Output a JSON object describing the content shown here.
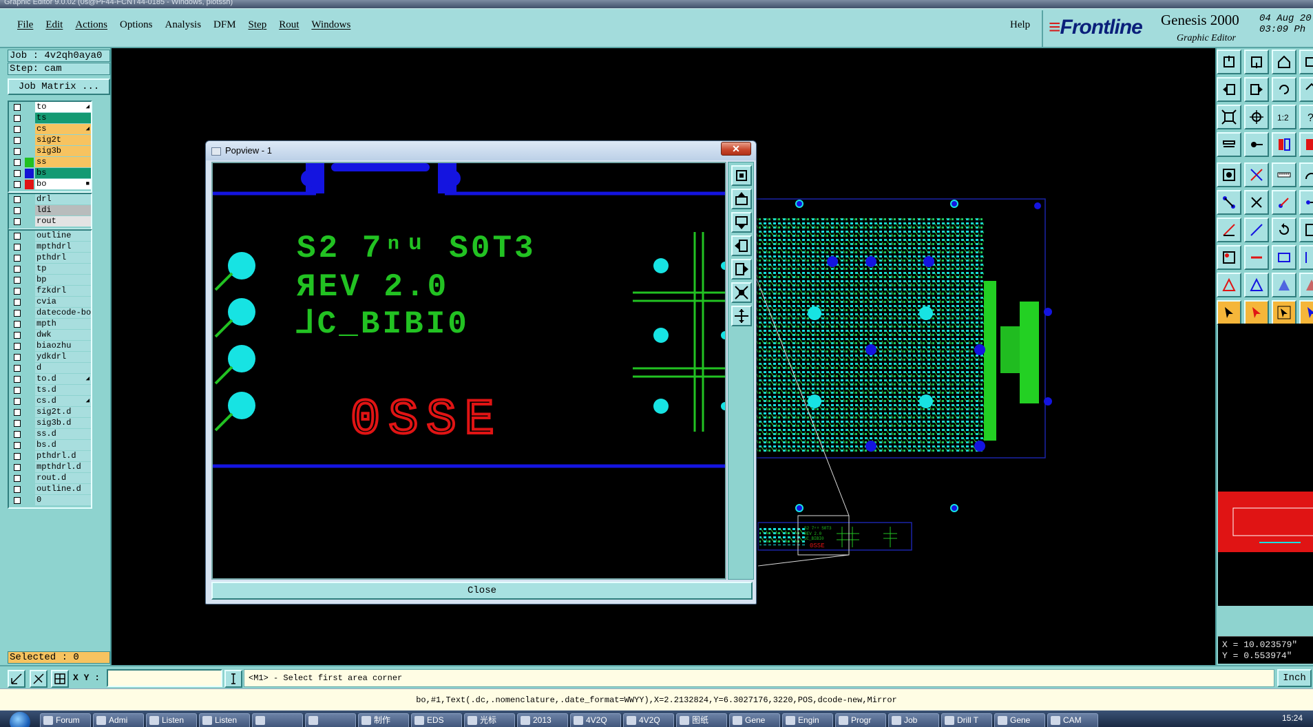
{
  "window": {
    "title": "Graphic Editor 9.0.02 (0s@PF44-FCNT44-0185 - Windows, plotssh)"
  },
  "menubar": {
    "menus": [
      "File",
      "Edit",
      "Actions",
      "Options",
      "Analysis",
      "DFM",
      "Step",
      "Rout",
      "Windows"
    ],
    "help": "Help"
  },
  "brand": {
    "logo": "Frontline",
    "product": "Genesis 2000",
    "subtitle": "Graphic Editor",
    "date": "04 Aug 20",
    "time": "03:09 Ph"
  },
  "job": {
    "job_label": "Job : 4v2qh0aya0",
    "step_label": "Step: cam",
    "matrix_button": "Job Matrix ..."
  },
  "layers_board": [
    {
      "name": "to",
      "bg": "#ffffff",
      "swatch": "",
      "mark": "◢"
    },
    {
      "name": "ts",
      "bg": "#149a73",
      "swatch": "",
      "mark": ""
    },
    {
      "name": "cs",
      "bg": "#f7c360",
      "swatch": "",
      "mark": "◢"
    },
    {
      "name": "sig2t",
      "bg": "#f7c360",
      "swatch": "",
      "mark": ""
    },
    {
      "name": "sig3b",
      "bg": "#f7c360",
      "swatch": "",
      "mark": ""
    },
    {
      "name": "ss",
      "bg": "#f7c360",
      "swatch": "#21c021",
      "mark": ""
    },
    {
      "name": "bs",
      "bg": "#149a73",
      "swatch": "#1414d4",
      "mark": ""
    },
    {
      "name": "bo",
      "bg": "#ffffff",
      "swatch": "#e01414",
      "mark": "■"
    }
  ],
  "layers_drill": [
    {
      "name": "drl",
      "bg": "#a8dede",
      "swatch": "",
      "mark": ""
    },
    {
      "name": "ldi",
      "bg": "#b8bcbc",
      "swatch": "",
      "mark": ""
    },
    {
      "name": "rout",
      "bg": "#e3e3e3",
      "swatch": "",
      "mark": ""
    }
  ],
  "layers_misc": [
    {
      "name": "outline",
      "mark": ""
    },
    {
      "name": "mpthdrl",
      "mark": ""
    },
    {
      "name": "pthdrl",
      "mark": ""
    },
    {
      "name": "tp",
      "mark": ""
    },
    {
      "name": "bp",
      "mark": ""
    },
    {
      "name": "fzkdrl",
      "mark": ""
    },
    {
      "name": "cvia",
      "mark": ""
    },
    {
      "name": "datecode-bo",
      "mark": ""
    },
    {
      "name": "mpth",
      "mark": ""
    },
    {
      "name": "dwk",
      "mark": ""
    },
    {
      "name": "biaozhu",
      "mark": ""
    },
    {
      "name": "ydkdrl",
      "mark": ""
    },
    {
      "name": "d",
      "mark": ""
    },
    {
      "name": "to.d",
      "mark": "◢"
    },
    {
      "name": "ts.d",
      "mark": ""
    },
    {
      "name": "cs.d",
      "mark": "◢"
    },
    {
      "name": "sig2t.d",
      "mark": ""
    },
    {
      "name": "sig3b.d",
      "mark": ""
    },
    {
      "name": "ss.d",
      "mark": ""
    },
    {
      "name": "bs.d",
      "mark": ""
    },
    {
      "name": "pthdrl.d",
      "mark": ""
    },
    {
      "name": "mpthdrl.d",
      "mark": ""
    },
    {
      "name": "rout.d",
      "mark": ""
    },
    {
      "name": "outline.d",
      "mark": ""
    },
    {
      "name": "0",
      "mark": ""
    }
  ],
  "selected": "Selected : 0",
  "popview": {
    "title": "Popview - 1",
    "close_x": "✕",
    "close_button": "Close",
    "silk_line1": "S2 7ⁿᵘ S0T3",
    "silk_line2": "ЯEV 2.0",
    "silk_line3": "⅃C_BIBI0",
    "datecode": "0SSE"
  },
  "overview": {
    "mini_line1": "S2 7ⁿᵘ S0T3",
    "mini_line2": "ЯEV 2.0",
    "mini_line3": "⅃C_BIBI0",
    "mini_datecode": "0SSE"
  },
  "coords": {
    "x": "X = 10.023579\"",
    "y": "Y = 0.553974\""
  },
  "cmd": {
    "xy_label": "X Y :",
    "xy_value": "",
    "prompt": "<M1> - Select first area corner",
    "unit": "Inch"
  },
  "status": "bo,#1,Text(.dc,.nomenclature,.date_format=WWYY),X=2.2132824,Y=6.3027176,3220,POS,dcode-new,Mirror",
  "taskbar": {
    "tasks": [
      "Forum",
      "Admi",
      "Listen",
      "Listen",
      "",
      "",
      "制作",
      "EDS",
      "光标",
      "2013",
      "4V2Q",
      "4V2Q",
      "图纸",
      "Gene",
      "Engin",
      "Progr",
      "Job",
      "Drill T",
      "Gene",
      "CAM"
    ],
    "clock": "15:24"
  },
  "colors": {
    "panel": "#8ed3cf",
    "menubar": "#a3dcdc",
    "silkscreen": "#22c222",
    "copper_blue": "#1414e0",
    "pad_cyan": "#17e3e3",
    "datecode_red": "#e01414"
  }
}
